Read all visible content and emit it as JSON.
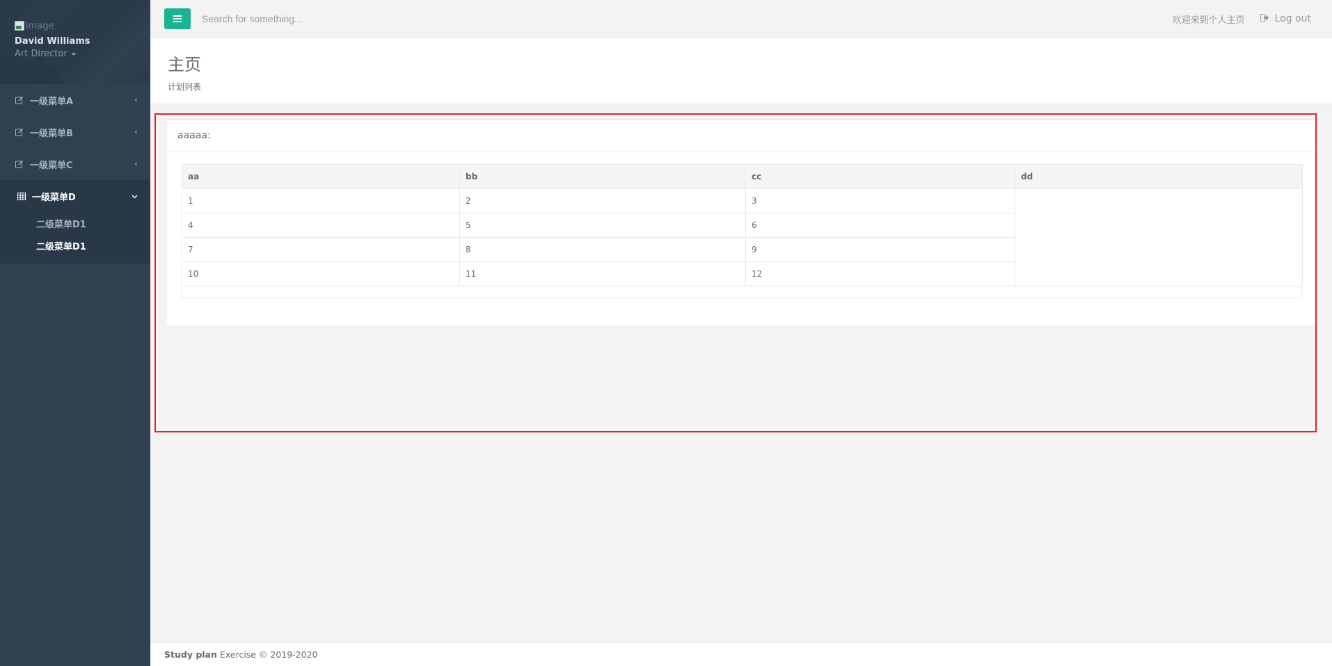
{
  "sidebar": {
    "profile": {
      "image_alt": "image",
      "name": "David Williams",
      "role": "Art Director"
    },
    "items": [
      {
        "label": "一级菜单A",
        "icon": "edit-icon",
        "expanded": false
      },
      {
        "label": "一级菜单B",
        "icon": "edit-icon",
        "expanded": false
      },
      {
        "label": "一级菜单C",
        "icon": "edit-icon",
        "expanded": false
      },
      {
        "label": "一级菜单D",
        "icon": "table-icon",
        "expanded": true,
        "children": [
          {
            "label": "二级菜单D1",
            "active": false
          },
          {
            "label": "二级菜单D1",
            "active": true
          }
        ]
      }
    ]
  },
  "topbar": {
    "menu_button_color": "#1ab394",
    "search": {
      "placeholder": "Search for something...",
      "value": ""
    },
    "welcome": "欢迎来到个人主页",
    "logout_label": "Log out"
  },
  "page": {
    "title": "主页",
    "subtitle": "计划列表"
  },
  "panel": {
    "title": "aaaaa:",
    "table": {
      "headers": [
        "aa",
        "bb",
        "cc",
        "dd"
      ],
      "rows": [
        [
          "1",
          "2",
          "3"
        ],
        [
          "4",
          "5",
          "6"
        ],
        [
          "7",
          "8",
          "9"
        ],
        [
          "10",
          "11",
          "12"
        ]
      ]
    }
  },
  "footer": {
    "brand": "Study plan",
    "text": "Exercise © 2019-2020"
  },
  "colors": {
    "sidebar_bg": "#2f4050",
    "accent": "#1ab394",
    "highlight": "#e8202a"
  }
}
